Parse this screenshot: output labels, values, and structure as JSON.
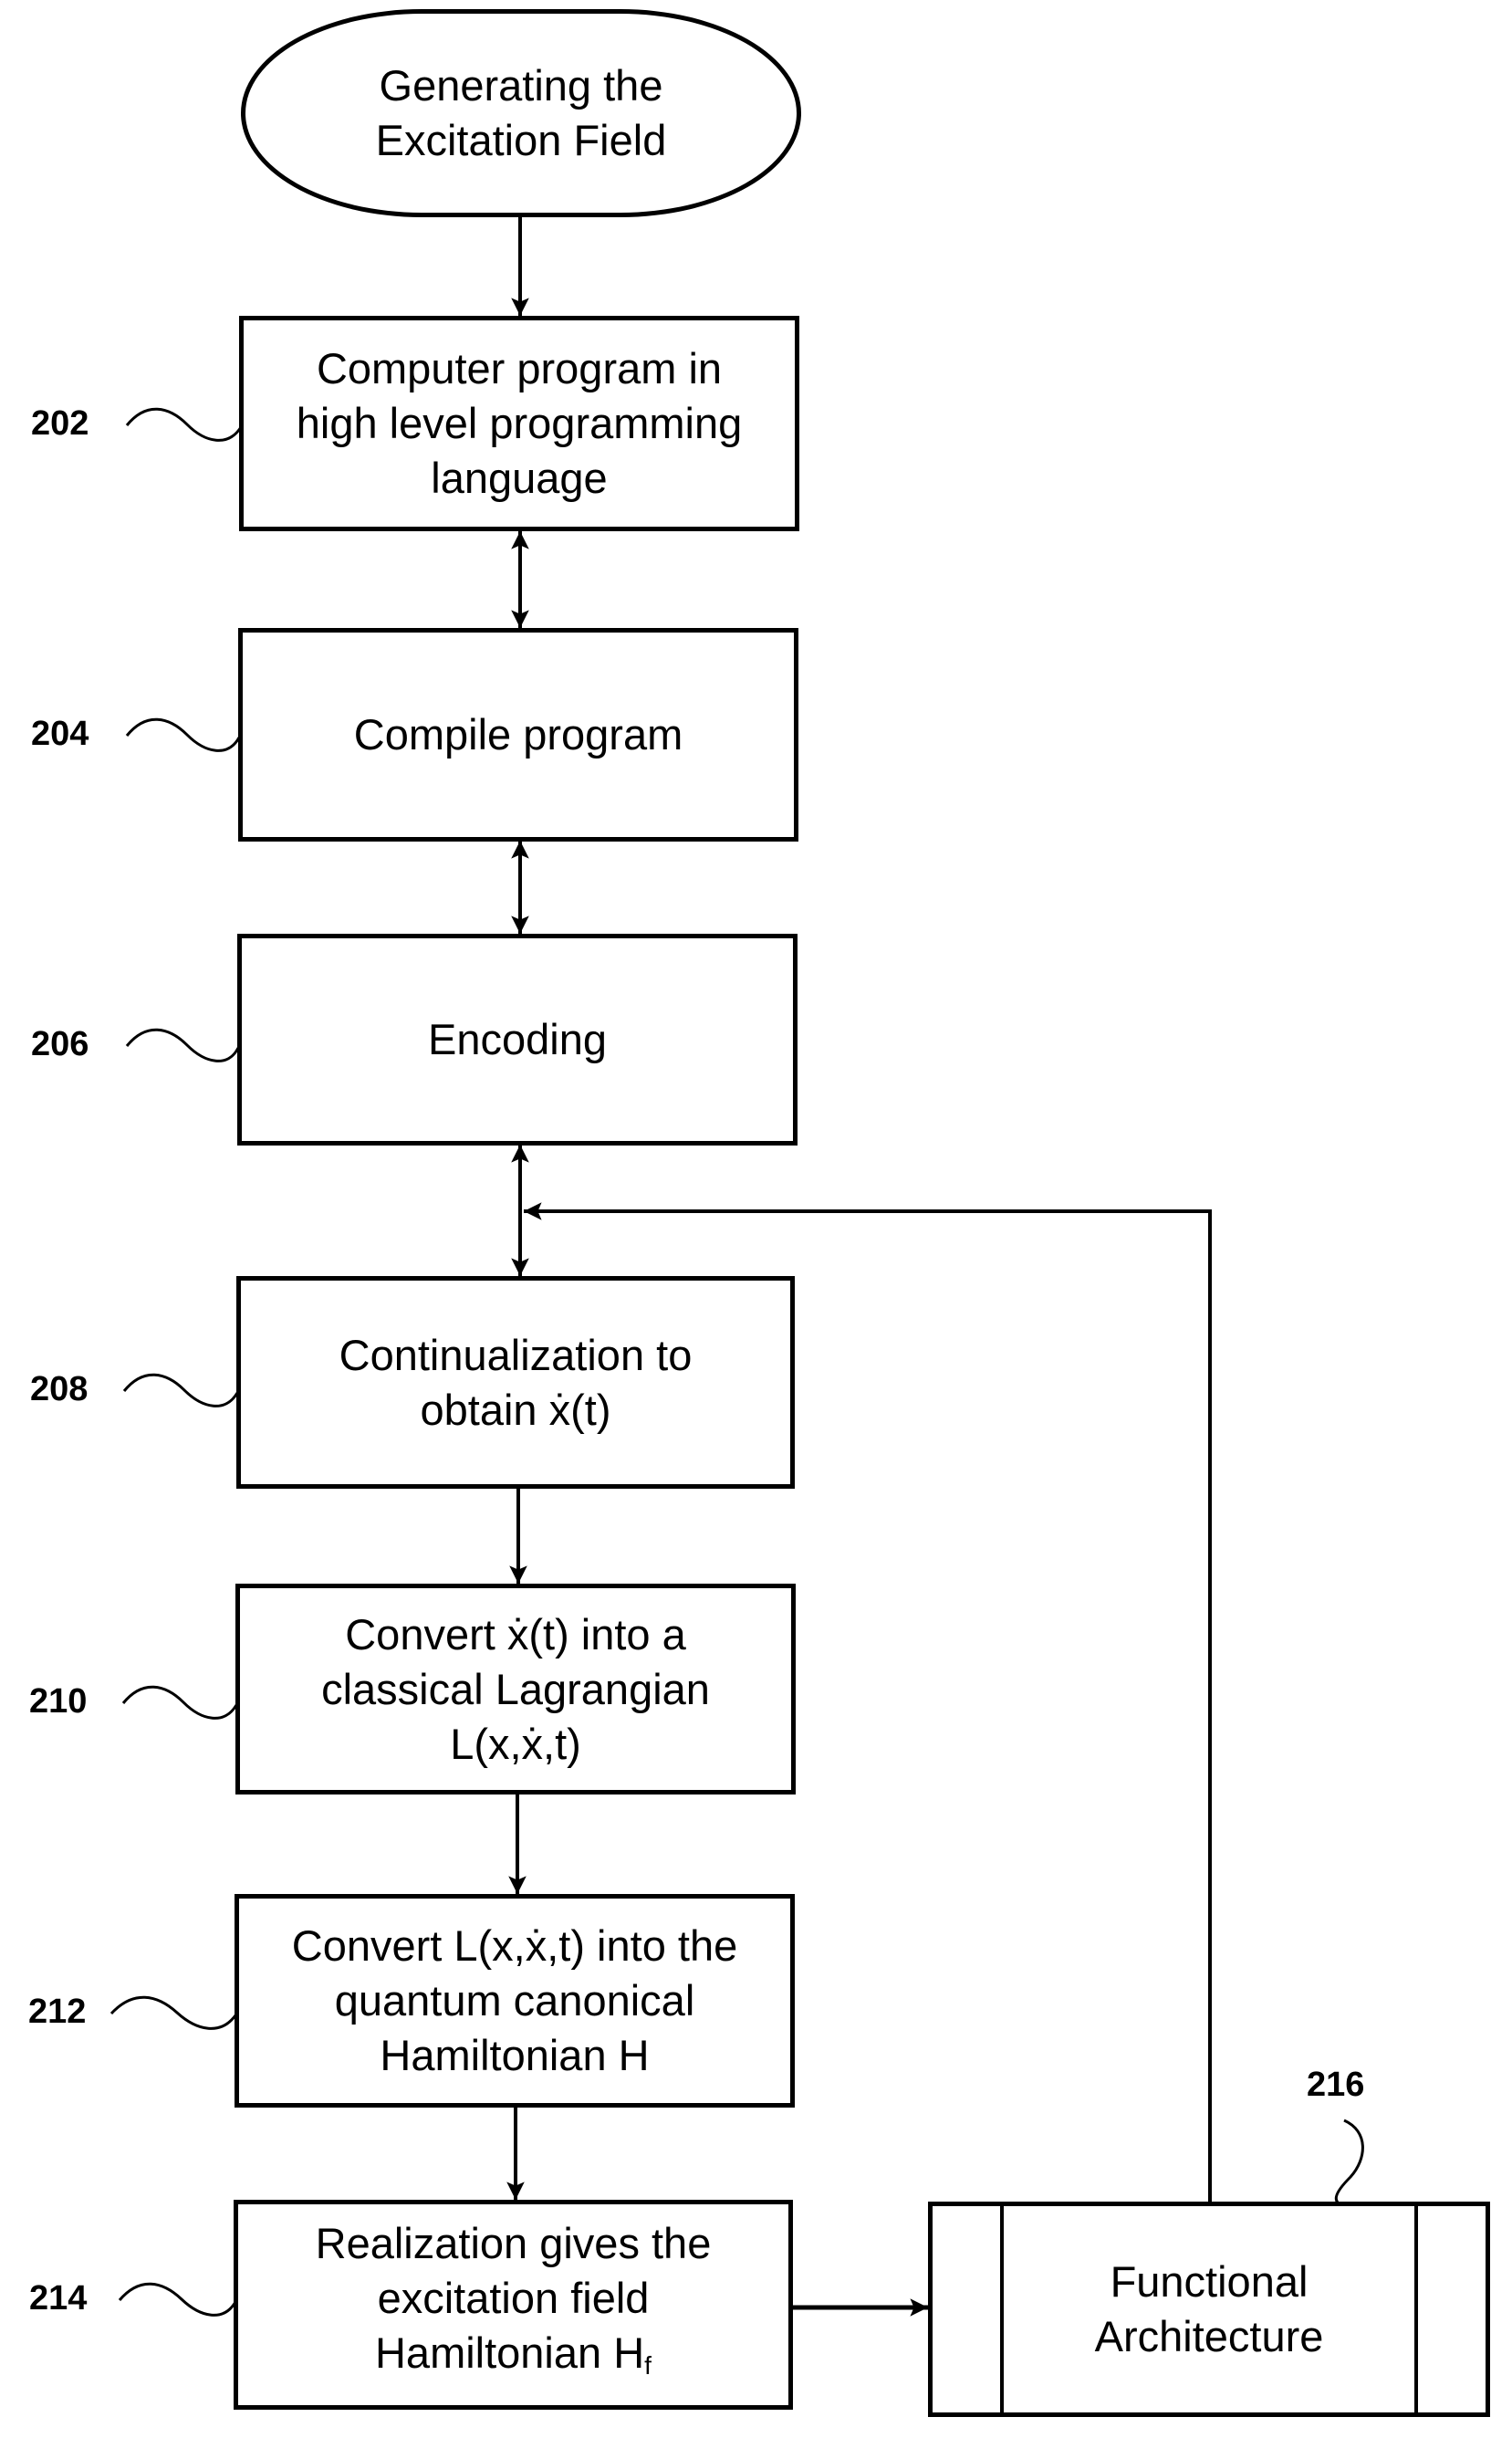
{
  "diagram": {
    "title": "Generating the Excitation Field",
    "start": {
      "lines": [
        "Generating the",
        "Excitation Field"
      ]
    },
    "steps": [
      {
        "ref": "202",
        "lines": [
          "Computer program in",
          "high level programming",
          "language"
        ]
      },
      {
        "ref": "204",
        "lines": [
          "Compile program"
        ]
      },
      {
        "ref": "206",
        "lines": [
          "Encoding"
        ]
      },
      {
        "ref": "208",
        "lines": [
          "Continualization to",
          "obtain ẋ(t)"
        ]
      },
      {
        "ref": "210",
        "lines": [
          "Convert ẋ(t) into a",
          "classical Lagrangian",
          "L(x,ẋ,t)"
        ]
      },
      {
        "ref": "212",
        "lines": [
          "Convert L(x,ẋ,t) into the",
          "quantum canonical",
          "Hamiltonian H"
        ]
      },
      {
        "ref": "214",
        "lines": [
          "Realization gives the",
          "excitation field",
          "Hamiltonian H"
        ],
        "subscript": "f"
      }
    ],
    "process": {
      "ref": "216",
      "lines": [
        "Functional",
        "Architecture"
      ]
    },
    "connections": [
      {
        "from": "start",
        "to": "202",
        "type": "one-way"
      },
      {
        "from": "202",
        "to": "204",
        "type": "two-way"
      },
      {
        "from": "204",
        "to": "206",
        "type": "two-way"
      },
      {
        "from": "206",
        "to": "208",
        "type": "two-way"
      },
      {
        "from": "208",
        "to": "210",
        "type": "one-way"
      },
      {
        "from": "210",
        "to": "212",
        "type": "one-way"
      },
      {
        "from": "212",
        "to": "214",
        "type": "one-way"
      },
      {
        "from": "214",
        "to": "216",
        "type": "one-way"
      },
      {
        "from": "216",
        "to": "206-208 link",
        "type": "feedback"
      }
    ]
  }
}
